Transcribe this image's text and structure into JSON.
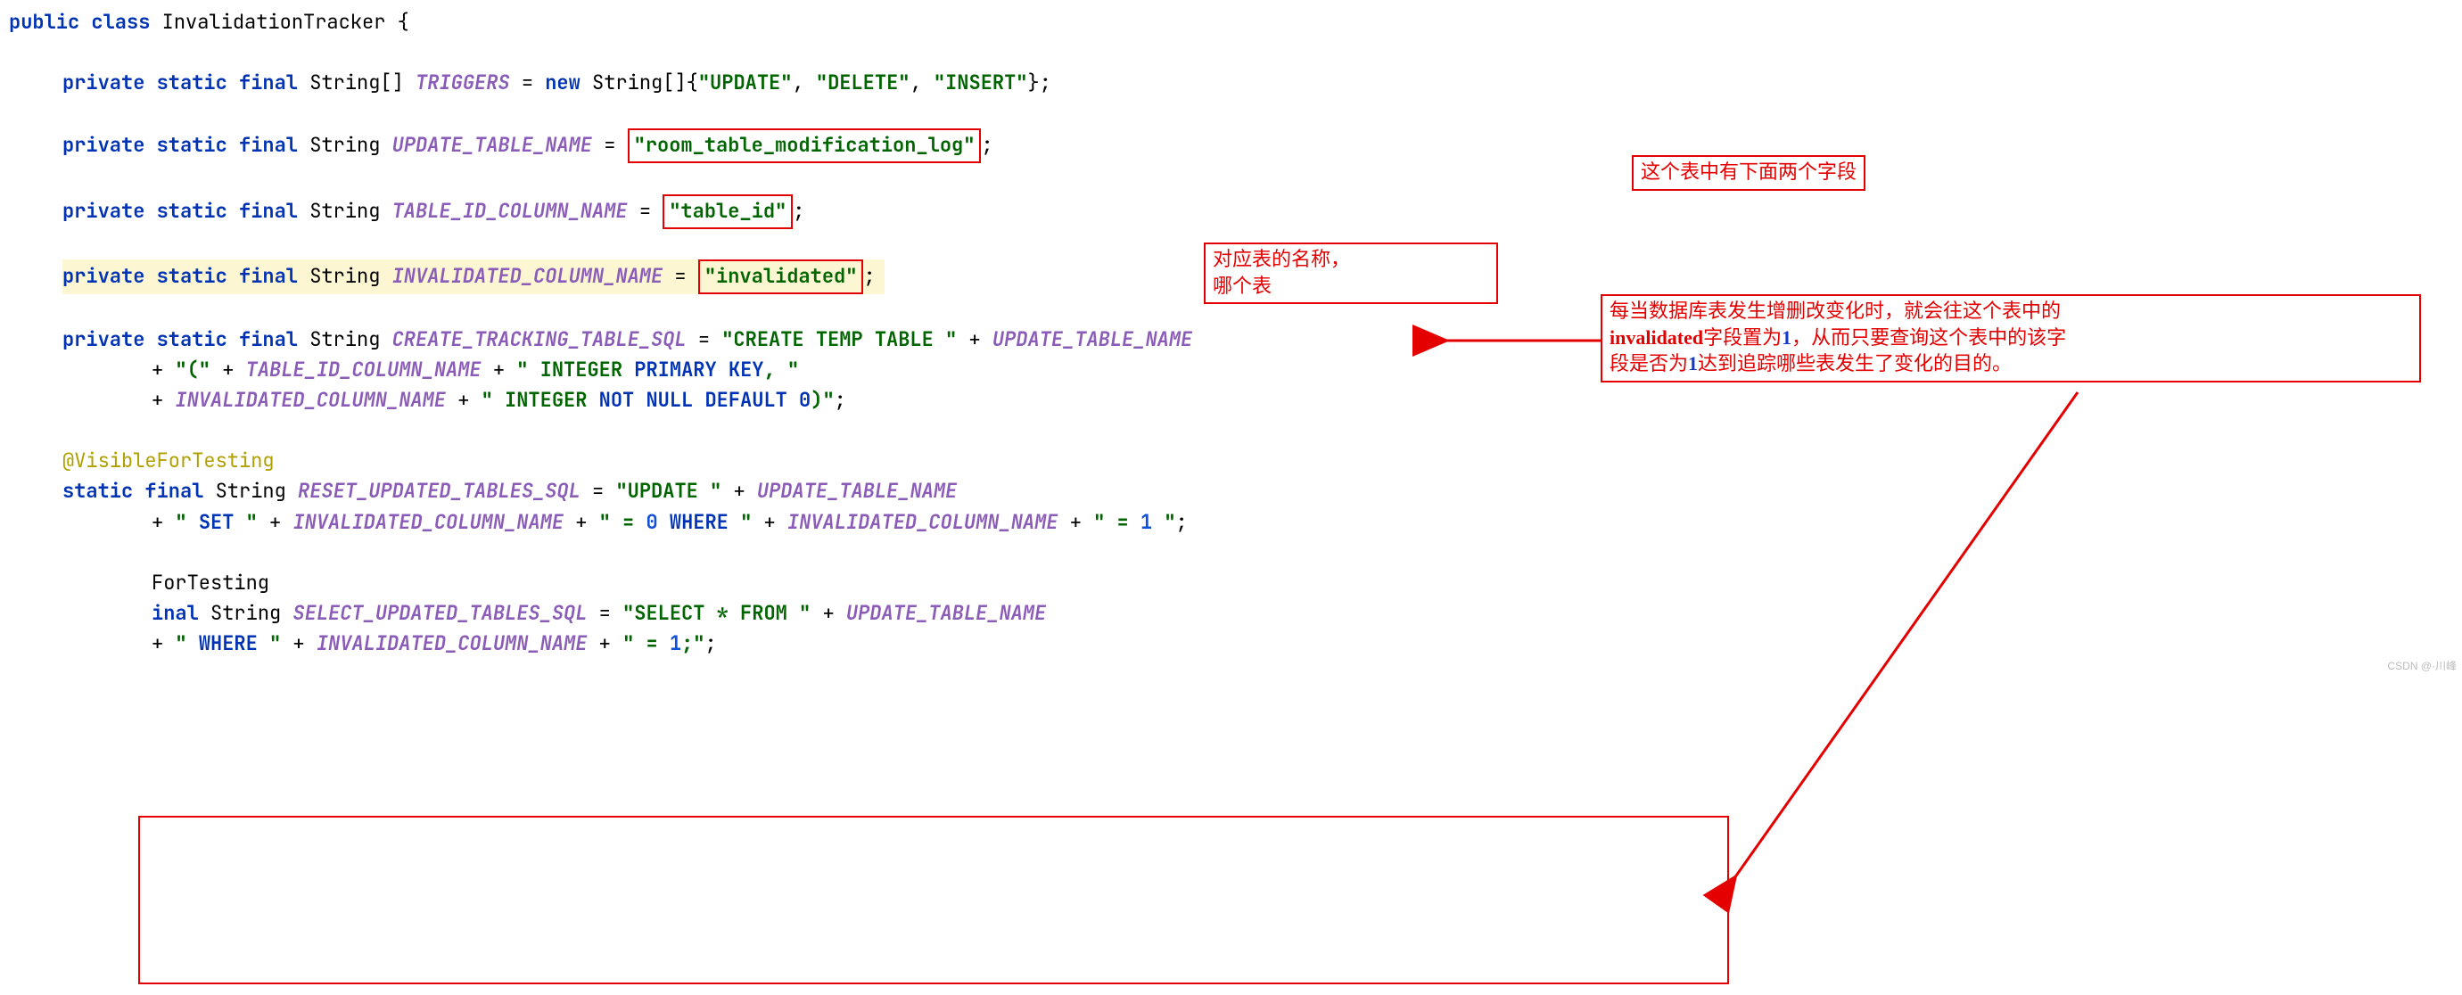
{
  "code": {
    "l1_kw1": "public",
    "l1_kw2": "class",
    "l1_name": "InvalidationTracker",
    "l1_brace": " {",
    "l2_mod": "private static final ",
    "l2_type": "String[] ",
    "l2_name": "TRIGGERS",
    "l2_eq": " = ",
    "l2_kwnew": "new ",
    "l2_type2": "String[]{",
    "l2_s1": "\"UPDATE\"",
    "l2_c1": ", ",
    "l2_s2": "\"DELETE\"",
    "l2_c2": ", ",
    "l2_s3": "\"INSERT\"",
    "l2_end": "};",
    "l3_mod": "private static final ",
    "l3_type": "String ",
    "l3_name": "UPDATE_TABLE_NAME",
    "l3_eq": " = ",
    "l3_val": "\"room_table_modification_log\"",
    "l3_end": ";",
    "l4_mod": "private static final ",
    "l4_type": "String ",
    "l4_name": "TABLE_ID_COLUMN_NAME",
    "l4_eq": " = ",
    "l4_val": "\"table_id\"",
    "l4_end": ";",
    "l5_mod": "private static final ",
    "l5_type": "String ",
    "l5_name": "INVALIDATED_COLUMN_NAME",
    "l5_eq": " = ",
    "l5_val": "\"invalidated\"",
    "l5_end": ";",
    "l6_mod": "private static final ",
    "l6_type": "String ",
    "l6_name": "CREATE_TRACKING_TABLE_SQL",
    "l6_eq": " = ",
    "l6_s1": "\"CREATE TEMP TABLE \"",
    "l6_p1": " + ",
    "l6_v1": "UPDATE_TABLE_NAME",
    "l7_p1": "+ ",
    "l7_s1": "\"(\"",
    "l7_p2": " + ",
    "l7_v1": "TABLE_ID_COLUMN_NAME",
    "l7_p3": " + ",
    "l7_s2": "\" INTEGER ",
    "l7_kw": "PRIMARY KEY",
    "l7_s2b": ", \"",
    "l8_p1": "+ ",
    "l8_v1": "INVALIDATED_COLUMN_NAME",
    "l8_p2": " + ",
    "l8_s1": "\" INTEGER ",
    "l8_kw": "NOT NULL DEFAULT 0",
    "l8_s1b": ")\"",
    "l8_end": ";",
    "l9_ann": "@VisibleForTesting",
    "l10_mod": "static final ",
    "l10_type": "String ",
    "l10_name": "RESET_UPDATED_TABLES_SQL",
    "l10_eq": " = ",
    "l10_s1": "\"UPDATE \"",
    "l10_p1": " + ",
    "l10_v1": "UPDATE_TABLE_NAME",
    "l11_p1": "+ ",
    "l11_s1": "\" ",
    "l11_kw1": "SET",
    "l11_s1b": " \"",
    "l11_p2": " + ",
    "l11_v1": "INVALIDATED_COLUMN_NAME",
    "l11_p3": " + ",
    "l11_s2": "\" = ",
    "l11_n1": "0",
    "l11_kw2": " WHERE ",
    "l11_s2b": "\"",
    "l11_p4": " + ",
    "l11_v2": "INVALIDATED_COLUMN_NAME",
    "l11_p5": " + ",
    "l11_s3": "\" = ",
    "l11_n2": "1",
    "l11_s3b": " \"",
    "l11_end": ";",
    "l12_txt": "ForTesting",
    "l13_mod": "inal ",
    "l13_type": "String ",
    "l13_name": "SELECT_UPDATED_TABLES_SQL",
    "l13_eq": " = ",
    "l13_s1": "\"SELECT * FROM \"",
    "l13_p1": " + ",
    "l13_v1": "UPDATE_TABLE_NAME",
    "l14_p1": "+ ",
    "l14_s1": "\" ",
    "l14_kw": "WHERE",
    "l14_s1b": " \"",
    "l14_p2": " + ",
    "l14_v1": "INVALIDATED_COLUMN_NAME",
    "l14_p3": " + ",
    "l14_s2": "\" = ",
    "l14_n": "1",
    "l14_s2b": ";\"",
    "l14_end": ";"
  },
  "callouts": {
    "c1": "这个表中有下面两个字段",
    "c2a": "对应表的名称，",
    "c2b": "哪个表",
    "c3a": "每当数据库表发生增删改变化时，就会往这个表中的",
    "c3b1": "invalidated",
    "c3b2": "字段置为",
    "c3b3": "1",
    "c3b4": "，从而只要查询这个表中的该字",
    "c3c1": "段是否为",
    "c3c2": "1",
    "c3c3": "达到追踪哪些表发生了变化的目的。"
  },
  "watermark": "CSDN @·川峰"
}
